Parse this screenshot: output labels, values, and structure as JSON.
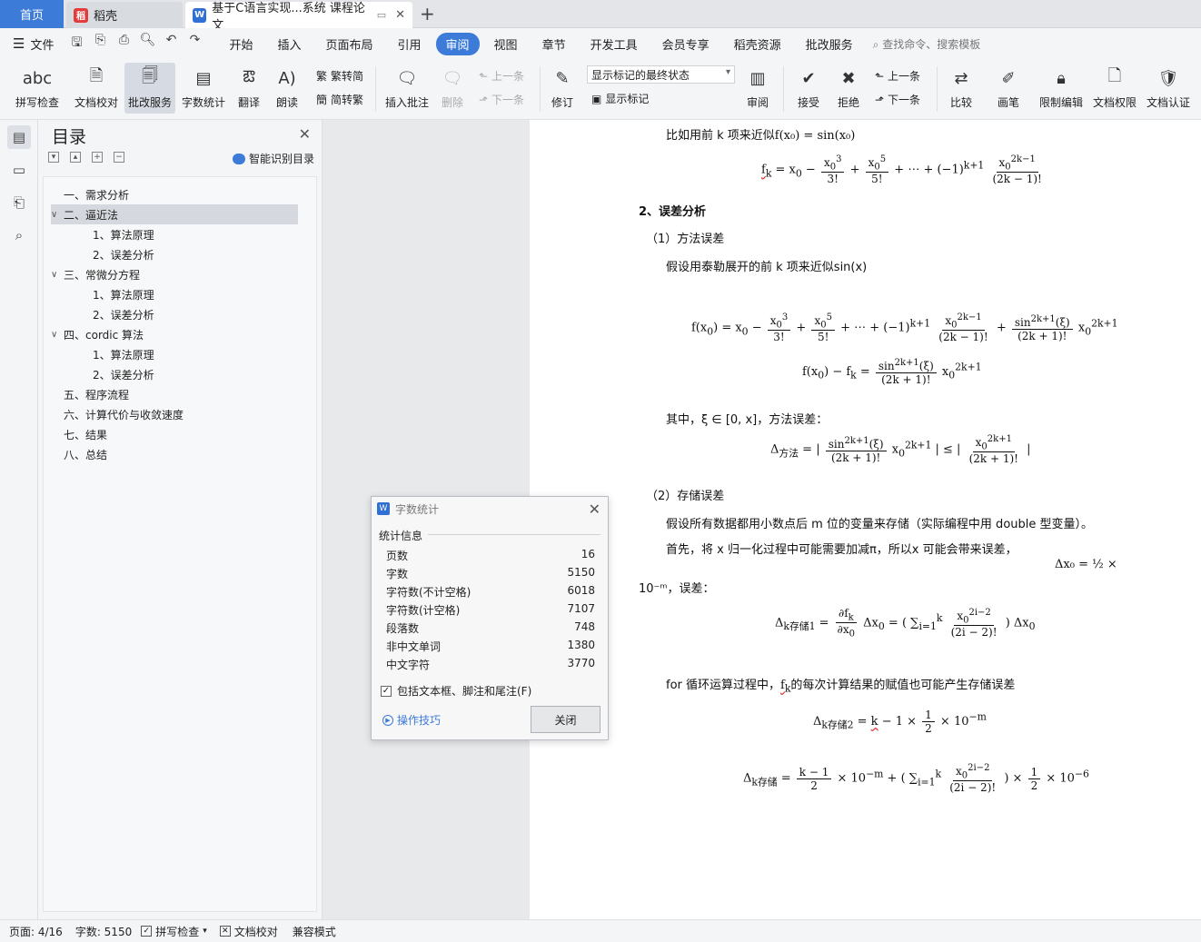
{
  "tabs": {
    "home": "首页",
    "shell": "稻壳",
    "doc": "基于C语言实现...系统 课程论文"
  },
  "menubar": {
    "file": "文件",
    "menus": [
      "开始",
      "插入",
      "页面布局",
      "引用",
      "审阅",
      "视图",
      "章节",
      "开发工具",
      "会员专享",
      "稻壳资源",
      "批改服务"
    ],
    "active_menu": "审阅",
    "search": "查找命令、搜索模板"
  },
  "ribbon": {
    "spell": "拼写检查",
    "proof": "文档校对",
    "correct": "批改服务",
    "wordcount": "字数统计",
    "translate": "翻译",
    "read": "朗读",
    "to_trad": "繁转简",
    "to_simp": "简转繁",
    "insert_comment": "插入批注",
    "delete": "删除",
    "prev_comment": "上一条",
    "next_comment": "下一条",
    "revise": "修订",
    "combo_value": "显示标记的最终状态",
    "show_markup": "显示标记",
    "review": "审阅",
    "accept": "接受",
    "reject": "拒绝",
    "prev": "上一条",
    "next": "下一条",
    "compare": "比较",
    "pen": "画笔",
    "restrict": "限制编辑",
    "permission": "文档权限",
    "certify": "文档认证"
  },
  "toc": {
    "title": "目录",
    "smart": "智能识别目录",
    "items": [
      {
        "label": "一、需求分析",
        "level": 1,
        "caret": ""
      },
      {
        "label": "二、逼近法",
        "level": 1,
        "caret": "∨"
      },
      {
        "label": "1、算法原理",
        "level": 2,
        "caret": ""
      },
      {
        "label": "2、误差分析",
        "level": 2,
        "caret": ""
      },
      {
        "label": "三、常微分方程",
        "level": 1,
        "caret": "∨"
      },
      {
        "label": "1、算法原理",
        "level": 2,
        "caret": ""
      },
      {
        "label": "2、误差分析",
        "level": 2,
        "caret": ""
      },
      {
        "label": "四、cordic 算法",
        "level": 1,
        "caret": "∨"
      },
      {
        "label": "1、算法原理",
        "level": 2,
        "caret": ""
      },
      {
        "label": "2、误差分析",
        "level": 2,
        "caret": ""
      },
      {
        "label": "五、程序流程",
        "level": 1,
        "caret": ""
      },
      {
        "label": "六、计算代价与收敛速度",
        "level": 1,
        "caret": ""
      },
      {
        "label": "七、结果",
        "level": 1,
        "caret": ""
      },
      {
        "label": "八、总结",
        "level": 1,
        "caret": ""
      }
    ],
    "selected_index": 1
  },
  "doc": {
    "line1": "比如用前 k 项来近似",
    "line1_math": "f(x₀) = sin(x₀)",
    "heading2": "2、误差分析",
    "sub1": "（1）方法误差",
    "para1": "假设用泰勒展开的前 k 项来近似sin(x)",
    "where": "其中，ξ ∈ [0, x]，方法误差：",
    "sub2": "（2）存储误差",
    "para2": "假设所有数据都用小数点后 m 位的变量来存储（实际编程中用 double 型变量）。",
    "para3": "首先，将 x 归一化过程中可能需要加减π，所以x 可能会带来误差，",
    "para3_tail": "Δx₀ = ½ ×",
    "para4": "10⁻ᵐ，误差：",
    "para5": "for 循环运算过程中，",
    "para5_b": "的每次计算结果的赋值也可能产生存储误差"
  },
  "dialog": {
    "title": "字数统计",
    "group": "统计信息",
    "rows": [
      {
        "label": "页数",
        "value": "16"
      },
      {
        "label": "字数",
        "value": "5150"
      },
      {
        "label": "字符数(不计空格)",
        "value": "6018"
      },
      {
        "label": "字符数(计空格)",
        "value": "7107"
      },
      {
        "label": "段落数",
        "value": "748"
      },
      {
        "label": "非中文单词",
        "value": "1380"
      },
      {
        "label": "中文字符",
        "value": "3770"
      }
    ],
    "checkbox": "包括文本框、脚注和尾注(F)",
    "checked": true,
    "tips": "操作技巧",
    "close": "关闭"
  },
  "status": {
    "page": "页面: 4/16",
    "words": "字数: 5150",
    "spell": "拼写检查",
    "proof": "文档校对",
    "compat": "兼容模式"
  },
  "colors": {
    "accent": "#3c7bd8",
    "spell_underline": "#e23b3b"
  }
}
